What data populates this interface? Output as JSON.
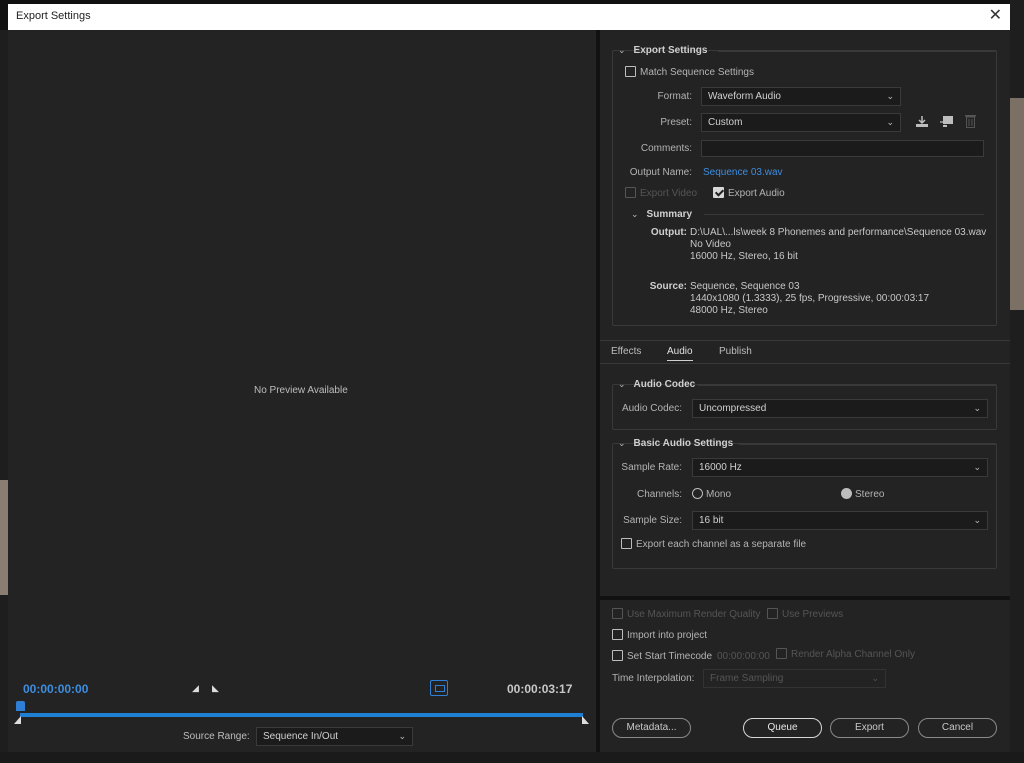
{
  "window": {
    "title": "Export Settings",
    "close_glyph": "✕"
  },
  "preview": {
    "no_preview": "No Preview Available",
    "timecode_in": "00:00:00:00",
    "timecode_out": "00:00:03:17",
    "mark_in_glyph": "◢",
    "mark_out_glyph": "◣",
    "source_range_label": "Source Range:",
    "source_range_value": "Sequence In/Out"
  },
  "export_settings": {
    "title": "Export Settings",
    "match_sequence_label": "Match Sequence Settings",
    "match_sequence_checked": false,
    "format_label": "Format:",
    "format_value": "Waveform Audio",
    "preset_label": "Preset:",
    "preset_value": "Custom",
    "comments_label": "Comments:",
    "comments_value": "",
    "output_name_label": "Output Name:",
    "output_name_value": "Sequence 03.wav",
    "export_video_label": "Export Video",
    "export_video_checked": false,
    "export_audio_label": "Export Audio",
    "export_audio_checked": true,
    "icons": [
      "save-preset-icon",
      "import-preset-icon",
      "delete-preset-icon"
    ]
  },
  "summary": {
    "title": "Summary",
    "output_label": "Output:",
    "output_lines": [
      "D:\\UAL\\...ls\\week 8 Phonemes and performance\\Sequence 03.wav",
      "No Video",
      "16000 Hz, Stereo, 16 bit"
    ],
    "source_label": "Source:",
    "source_lines": [
      "Sequence, Sequence 03",
      "1440x1080 (1.3333), 25 fps, Progressive, 00:00:03:17",
      "48000 Hz, Stereo"
    ]
  },
  "tabs": [
    {
      "label": "Effects",
      "active": false
    },
    {
      "label": "Audio",
      "active": true
    },
    {
      "label": "Publish",
      "active": false
    }
  ],
  "audio_codec": {
    "title": "Audio Codec",
    "codec_label": "Audio Codec:",
    "codec_value": "Uncompressed"
  },
  "basic_audio": {
    "title": "Basic Audio Settings",
    "sample_rate_label": "Sample Rate:",
    "sample_rate_value": "16000 Hz",
    "channels_label": "Channels:",
    "mono_label": "Mono",
    "stereo_label": "Stereo",
    "selected_channel": "Stereo",
    "sample_size_label": "Sample Size:",
    "sample_size_value": "16 bit",
    "separate_channels_label": "Export each channel as a separate file"
  },
  "render_options": {
    "max_quality_label": "Use Maximum Render Quality",
    "use_previews_label": "Use Previews",
    "import_project_label": "Import into project",
    "start_timecode_label": "Set Start Timecode",
    "start_timecode_value": "00:00:00:00",
    "alpha_only_label": "Render Alpha Channel Only",
    "time_interp_label": "Time Interpolation:",
    "time_interp_value": "Frame Sampling"
  },
  "buttons": {
    "metadata": "Metadata...",
    "queue": "Queue",
    "export": "Export",
    "cancel": "Cancel"
  },
  "colors": {
    "accent": "#3d8de0",
    "panel": "#232323",
    "field": "#1b1b1b"
  }
}
